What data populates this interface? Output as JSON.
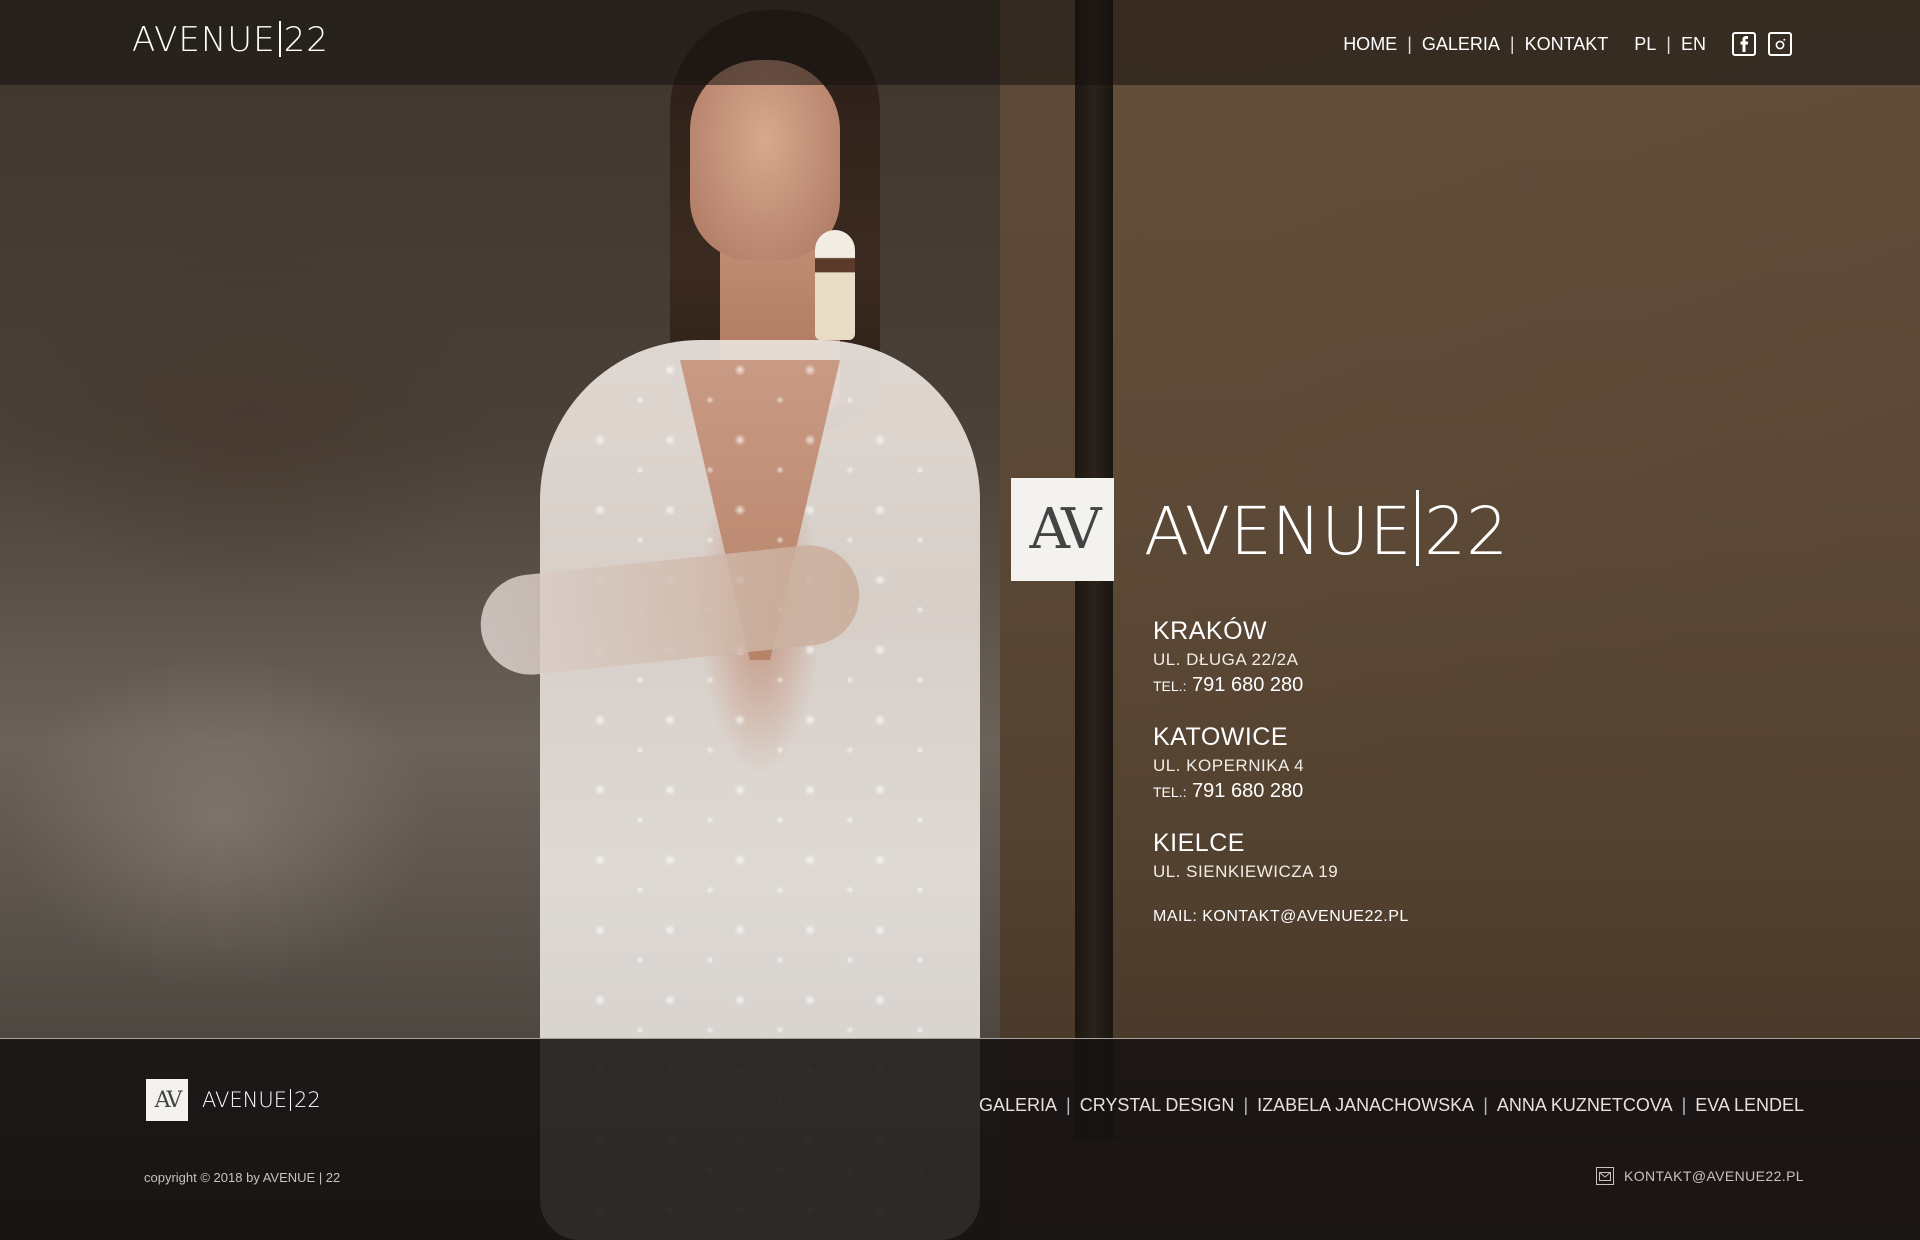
{
  "header": {
    "brand_left": "AVENUE",
    "brand_right": "22",
    "nav": [
      {
        "label": "HOME"
      },
      {
        "label": "GALERIA"
      },
      {
        "label": "KONTAKT"
      }
    ],
    "lang": [
      "PL",
      "EN"
    ],
    "social_icons": [
      "facebook-icon",
      "instagram-icon"
    ]
  },
  "hero": {
    "logo_mark": "AV",
    "brand_left": "AVENUE",
    "brand_right": "22"
  },
  "contacts": {
    "locations": [
      {
        "city": "KRAKÓW",
        "address": "UL. DŁUGA 22/2A",
        "tel_label": "TEL.:",
        "tel": "791 680 280"
      },
      {
        "city": "KATOWICE",
        "address": "UL. KOPERNIKA 4",
        "tel_label": "TEL.:",
        "tel": "791 680 280"
      },
      {
        "city": "KIELCE",
        "address": "UL. SIENKIEWICZA 19"
      }
    ],
    "mail_label": "MAIL:",
    "mail": "KONTAKT@AVENUE22.PL"
  },
  "footer": {
    "logo_mark": "AV",
    "brand_left": "AVENUE",
    "brand_right": "22",
    "nav": [
      {
        "label": "GALERIA"
      },
      {
        "label": "CRYSTAL DESIGN"
      },
      {
        "label": "IZABELA JANACHOWSKA"
      },
      {
        "label": "ANNA KUZNETCOVA"
      },
      {
        "label": "EVA LENDEL"
      }
    ],
    "copyright": "copyright © 2018 by AVENUE | 22",
    "mail": "KONTAKT@AVENUE22.PL"
  }
}
